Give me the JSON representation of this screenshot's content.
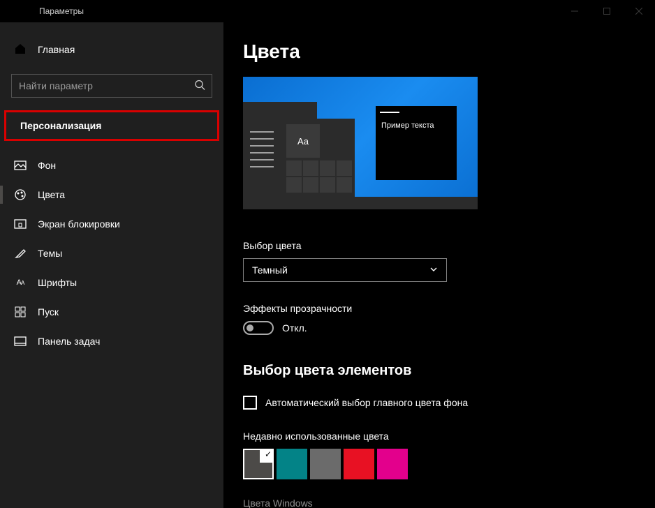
{
  "titlebar": {
    "title": "Параметры"
  },
  "sidebar": {
    "home": "Главная",
    "search_placeholder": "Найти параметр",
    "section": "Персонализация",
    "items": [
      {
        "label": "Фон"
      },
      {
        "label": "Цвета"
      },
      {
        "label": "Экран блокировки"
      },
      {
        "label": "Темы"
      },
      {
        "label": "Шрифты"
      },
      {
        "label": "Пуск"
      },
      {
        "label": "Панель задач"
      }
    ]
  },
  "main": {
    "title": "Цвета",
    "preview": {
      "sample_text": "Пример текста",
      "aa": "Aa"
    },
    "color_mode": {
      "label": "Выбор цвета",
      "value": "Темный"
    },
    "transparency": {
      "label": "Эффекты прозрачности",
      "state_text": "Откл."
    },
    "accent": {
      "heading": "Выбор цвета элементов",
      "auto_label": "Автоматический выбор главного цвета фона",
      "recent_label": "Недавно использованные цвета",
      "recent_colors": [
        "#4c4a48",
        "#038387",
        "#6b6b6b",
        "#e81123",
        "#e3008c"
      ],
      "windows_colors_label": "Цвета Windows"
    }
  }
}
